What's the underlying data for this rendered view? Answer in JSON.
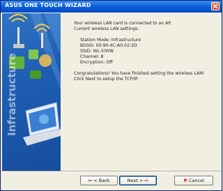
{
  "window": {
    "title": "ASUS ONE TOUCH WIZARD"
  },
  "banner": {
    "vertical_text": "Infrastructure"
  },
  "content": {
    "intro": [
      "Your wireless LAN card is connected to an AP.",
      "Current wireless LAN settings:"
    ],
    "settings": [
      "Station Mode: Infrastructure",
      "BSSID: 00:90:4C:A0:02:2D",
      "SSID: WL-500W",
      "Channel: 8",
      "Encryption: Off"
    ],
    "congrats": [
      "Congratulations! You have finished setting the wireless LAN!",
      "Click Next to setup the TCP/IP."
    ]
  },
  "buttons": {
    "back_label": "< Back",
    "next_label": "Next >",
    "cancel_label": "Cancel"
  },
  "icons": {
    "close": "close-icon",
    "back_arrow": "arrow-left-icon",
    "next_arrow": "arrow-right-icon",
    "cancel": "x-icon"
  },
  "colors": {
    "titlebar": "#0a5fd8",
    "banner": "#1e5eb3"
  }
}
